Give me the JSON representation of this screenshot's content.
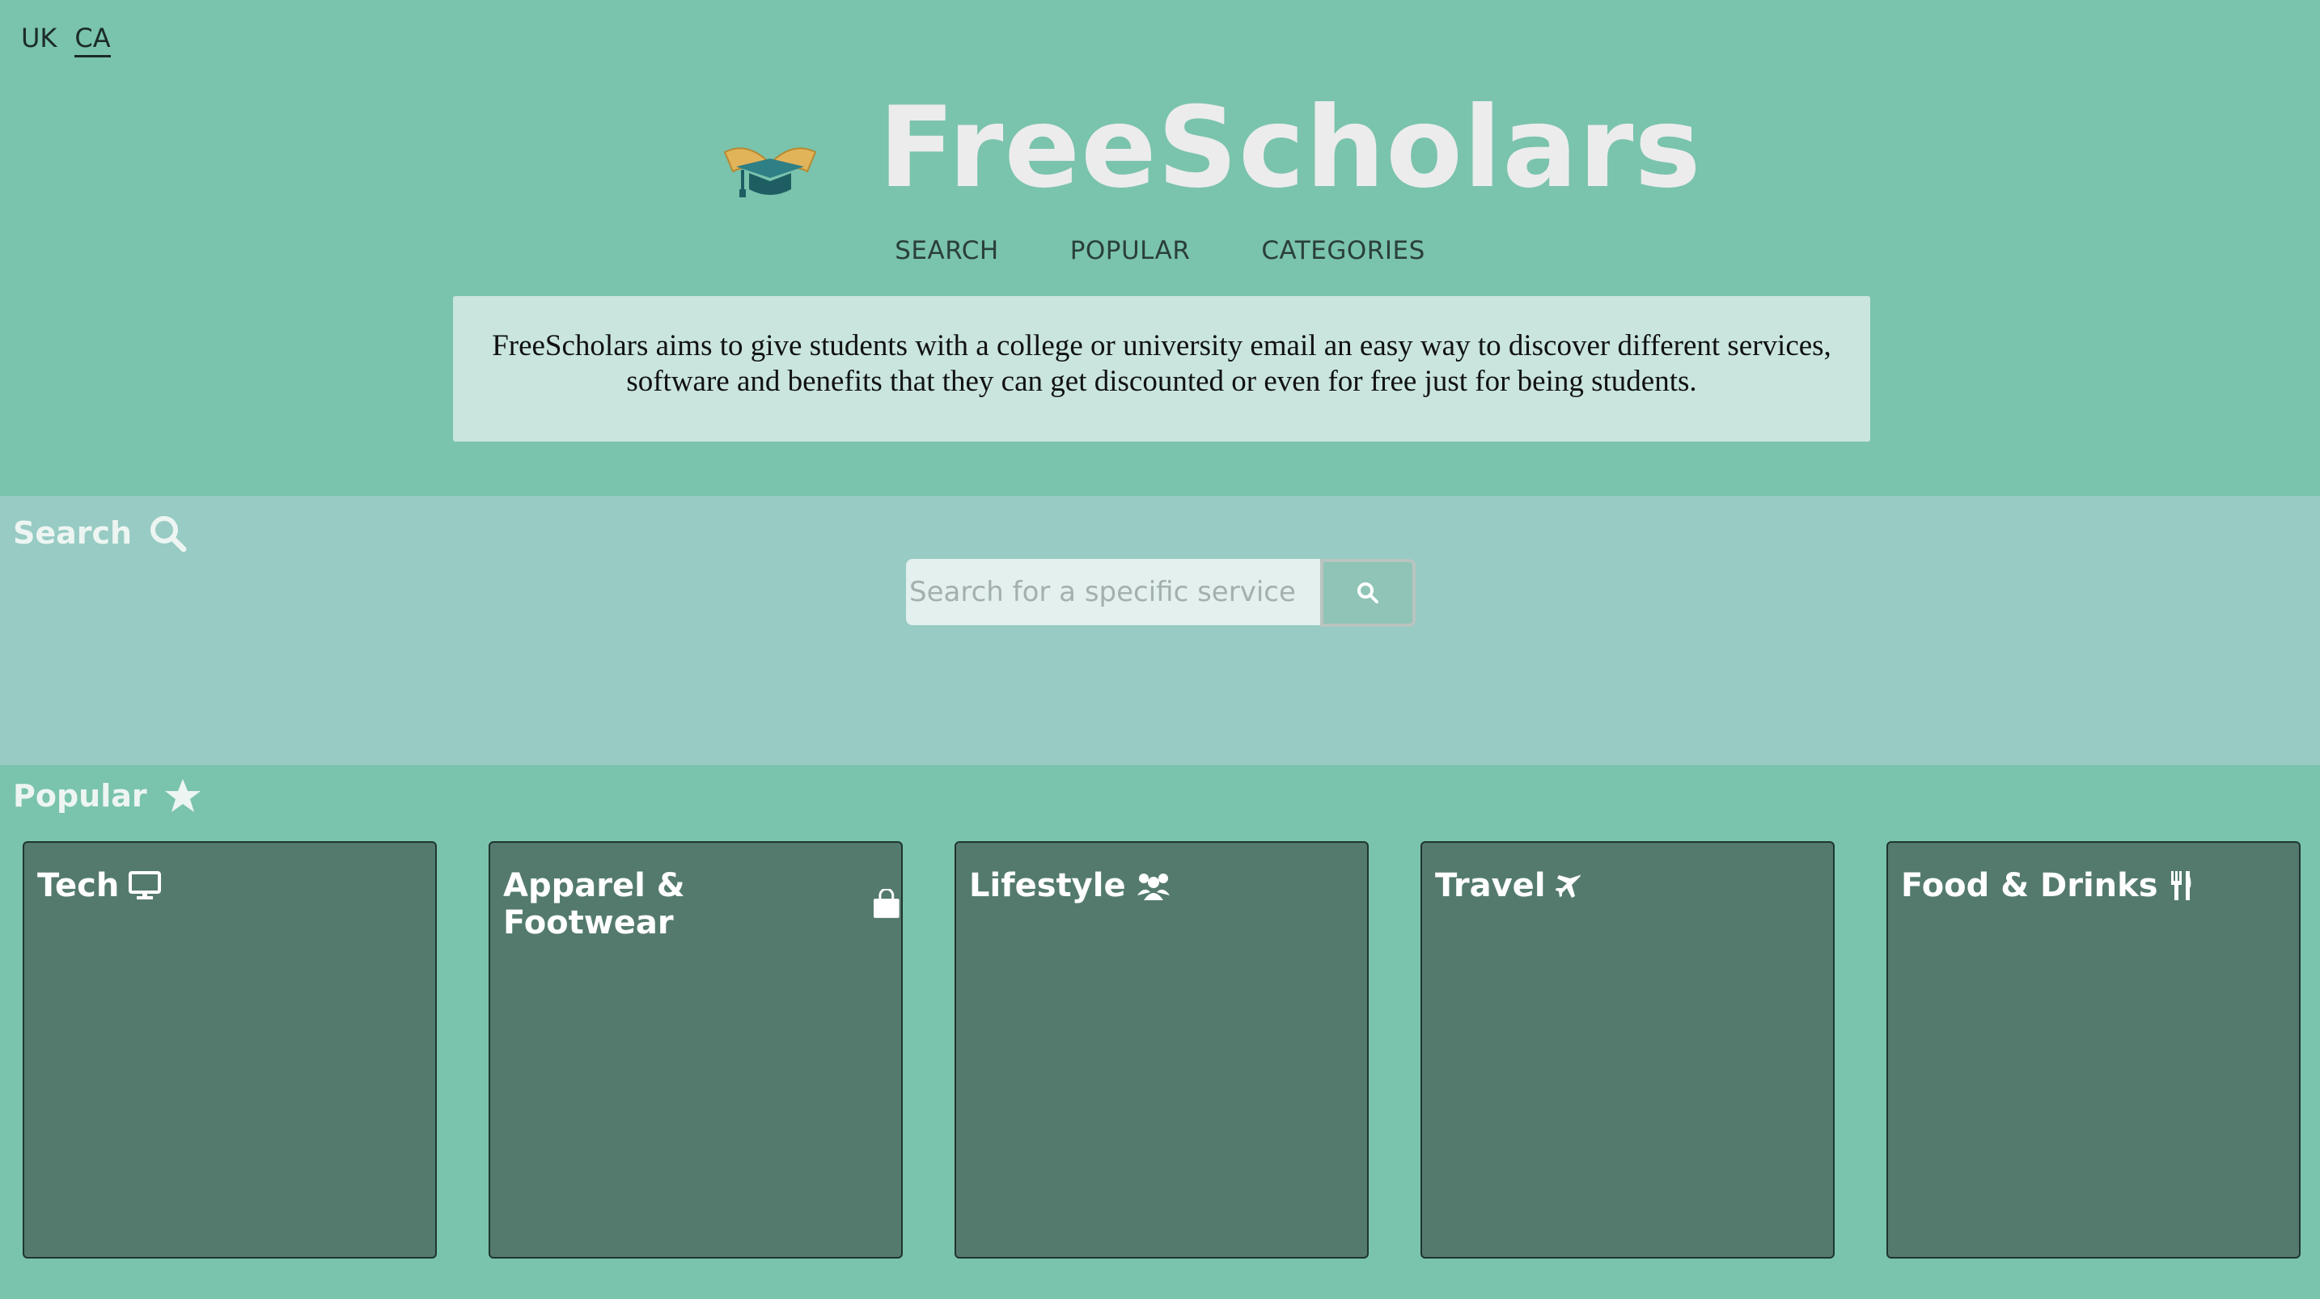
{
  "header": {
    "regions": [
      {
        "label": "UK"
      },
      {
        "label": "CA"
      }
    ],
    "brand": "FreeScholars",
    "nav": [
      {
        "label": "SEARCH"
      },
      {
        "label": "POPULAR"
      },
      {
        "label": "CATEGORIES"
      }
    ],
    "intro": "FreeScholars aims to give students with a college or university email an easy way to discover different services, software and benefits that they can get discounted or even for free just for being students."
  },
  "search": {
    "heading": "Search",
    "placeholder": "Search for a specific service"
  },
  "popular": {
    "heading": "Popular",
    "cards": [
      {
        "title": "Tech",
        "icon": "desktop-icon"
      },
      {
        "title": "Apparel & Footwear",
        "icon": "shopping-bag-icon"
      },
      {
        "title": "Lifestyle",
        "icon": "users-icon"
      },
      {
        "title": "Travel",
        "icon": "plane-icon"
      },
      {
        "title": "Food & Drinks",
        "icon": "utensils-icon"
      }
    ]
  },
  "colors": {
    "header_bg": "#7ac3ad",
    "search_bg": "#97cbc3",
    "card_bg": "#547a6e",
    "intro_bg": "#c9e5de",
    "brand_text": "#ececec"
  }
}
